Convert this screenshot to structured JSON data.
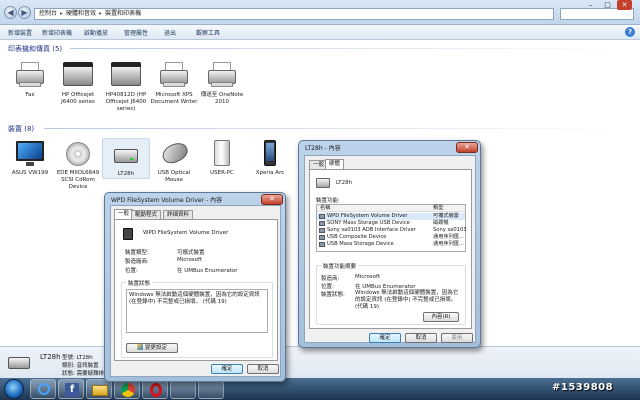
{
  "explorer": {
    "breadcrumbs": [
      "控制台",
      "硬體和音效",
      "裝置和印表機"
    ],
    "toolbar": [
      "新增裝置",
      "新增印表機",
      "啟動播放",
      "管理屬性",
      "退出",
      "觀察工具"
    ]
  },
  "printers_section": {
    "header": "印表機和傳真 (5)",
    "items": [
      {
        "label": "Fax",
        "icon": "fax-icon"
      },
      {
        "label": "HP Officejet J6400 series",
        "icon": "multifunction-printer-icon"
      },
      {
        "label": "HP40812D (HP Officejet J6400 series)",
        "icon": "multifunction-printer-icon"
      },
      {
        "label": "Microsoft XPS Document Writer",
        "icon": "printer-icon"
      },
      {
        "label": "傳送至 OneNote 2010",
        "icon": "printer-icon"
      }
    ]
  },
  "devices_section": {
    "header": "裝置 (8)",
    "items": [
      {
        "label": "ASUS VW199",
        "icon": "monitor-icon"
      },
      {
        "label": "EDE MIIOL6849 SCSI CdRom Device",
        "icon": "cd-drive-icon"
      },
      {
        "label": "LT28h",
        "icon": "drive-icon"
      },
      {
        "label": "USB Optical Mouse",
        "icon": "mouse-icon"
      },
      {
        "label": "USER-PC",
        "icon": "computer-icon"
      },
      {
        "label": "Xperia Arc",
        "icon": "phone-icon"
      }
    ]
  },
  "details_pane": {
    "name": "LT28h",
    "fields": [
      {
        "k": "型號:",
        "v": "LT28h"
      },
      {
        "k": "類別:",
        "v": "音訊裝置"
      },
      {
        "k": "狀態:",
        "v": "需要疑難排解"
      }
    ]
  },
  "dialog_wpd": {
    "title": "WPD FileSystem Volume Driver - 內容",
    "tabs": [
      "一般",
      "驅動程式",
      "詳細資料"
    ],
    "device_name": "WPD FileSystem Volume Driver",
    "props": [
      {
        "k": "裝置類型:",
        "v": "可攜式裝置"
      },
      {
        "k": "製造廠商:",
        "v": "Microsoft"
      },
      {
        "k": "位置:",
        "v": "在 UMBus Enumerator"
      }
    ],
    "status_group": "裝置狀態",
    "status_text": "Windows 無法啟動這個硬體裝置，因為它的設定資訊 (在登錄中) 不完整或已損壞。 (代碼 19)",
    "change_button": "變更設定",
    "ok": "確定",
    "cancel": "取消"
  },
  "dialog_lt28h": {
    "title": "LT28h - 內容",
    "tabs": [
      "一般",
      "硬體"
    ],
    "device_name": "LT28h",
    "functions_label": "裝置功能:",
    "columns": [
      "名稱",
      "類型"
    ],
    "rows": [
      {
        "name": "WPD FileSystem Volume Driver",
        "type": "可攜式裝置"
      },
      {
        "name": "SONY Mass Storage USB Device",
        "type": "磁碟機"
      },
      {
        "name": "Sony sa0103 ADB Interface Driver",
        "type": "Sony sa0103"
      },
      {
        "name": "USB Composite Device",
        "type": "通用序列匯..."
      },
      {
        "name": "USB Mass Storage Device",
        "type": "通用序列匯..."
      }
    ],
    "summary_group": "裝置功能摘要",
    "summary": [
      {
        "k": "製造商:",
        "v": "Microsoft"
      },
      {
        "k": "位置:",
        "v": "在 UMBus Enumerator"
      },
      {
        "k": "裝置狀態:",
        "v": "Windows 無法啟動這個硬體裝置，因為它的設定資訊 (在登錄中) 不完整或已損壞。 (代碼 19)"
      }
    ],
    "properties_button": "內容(R)",
    "ok": "確定",
    "cancel": "取消",
    "apply": "套用"
  },
  "watermark": "#1539808"
}
